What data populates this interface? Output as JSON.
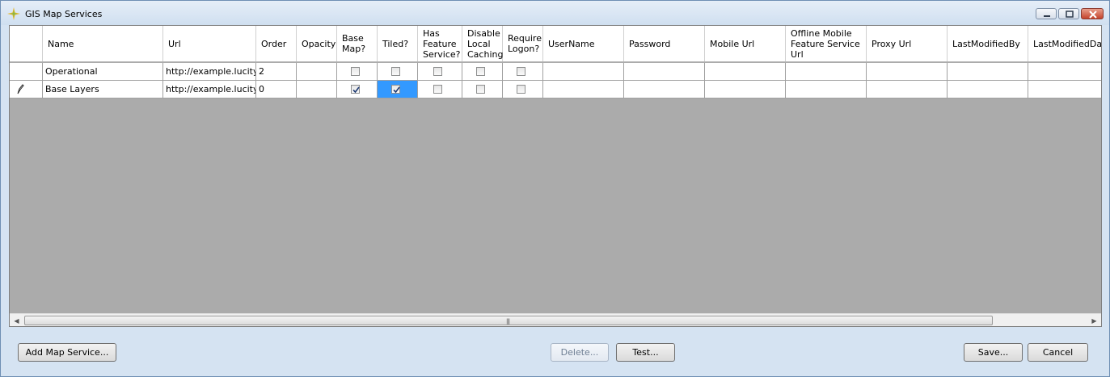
{
  "window": {
    "title": "GIS Map Services",
    "icon": "app-star-icon"
  },
  "grid": {
    "columns": [
      {
        "key": "rowheader",
        "label": ""
      },
      {
        "key": "name",
        "label": "Name"
      },
      {
        "key": "url",
        "label": "Url"
      },
      {
        "key": "order",
        "label": "Order"
      },
      {
        "key": "opacity",
        "label": "Opacity"
      },
      {
        "key": "basemap",
        "label": "Base Map?"
      },
      {
        "key": "tiled",
        "label": "Tiled?"
      },
      {
        "key": "hasfeature",
        "label": "Has Feature Service?"
      },
      {
        "key": "disablecache",
        "label": "Disable Local Caching"
      },
      {
        "key": "requirelogon",
        "label": "Require Logon?"
      },
      {
        "key": "username",
        "label": "UserName"
      },
      {
        "key": "password",
        "label": "Password"
      },
      {
        "key": "mobileurl",
        "label": "Mobile Url"
      },
      {
        "key": "offlineurl",
        "label": "Offline Mobile Feature Service Url"
      },
      {
        "key": "proxyurl",
        "label": "Proxy Url"
      },
      {
        "key": "lastby",
        "label": "LastModifiedBy"
      },
      {
        "key": "lastdate",
        "label": "LastModifiedDate"
      }
    ],
    "rows": [
      {
        "name": "Operational",
        "url": "http://example.lucity...",
        "order": "2",
        "opacity": "",
        "basemap": false,
        "tiled": false,
        "hasfeature": false,
        "disablecache": false,
        "requirelogon": false,
        "username": "",
        "password": "",
        "mobileurl": "",
        "offlineurl": "",
        "proxyurl": "",
        "lastby": "",
        "lastdate": "",
        "editing": false
      },
      {
        "name": "Base Layers",
        "url": "http://example.lucity...",
        "order": "0",
        "opacity": "",
        "basemap": true,
        "tiled": true,
        "hasfeature": false,
        "disablecache": false,
        "requirelogon": false,
        "username": "",
        "password": "",
        "mobileurl": "",
        "offlineurl": "",
        "proxyurl": "",
        "lastby": "",
        "lastdate": "",
        "editing": true,
        "editing_icon": "pencil-icon",
        "selected_cell": "tiled"
      }
    ],
    "scrollbar_grip": "|||"
  },
  "buttons": {
    "add": "Add Map Service...",
    "delete": "Delete...",
    "test": "Test...",
    "save": "Save...",
    "cancel": "Cancel"
  },
  "colors": {
    "selection": "#3399ff",
    "grid_background": "#ababab",
    "window_background": "#d5e3f2"
  }
}
